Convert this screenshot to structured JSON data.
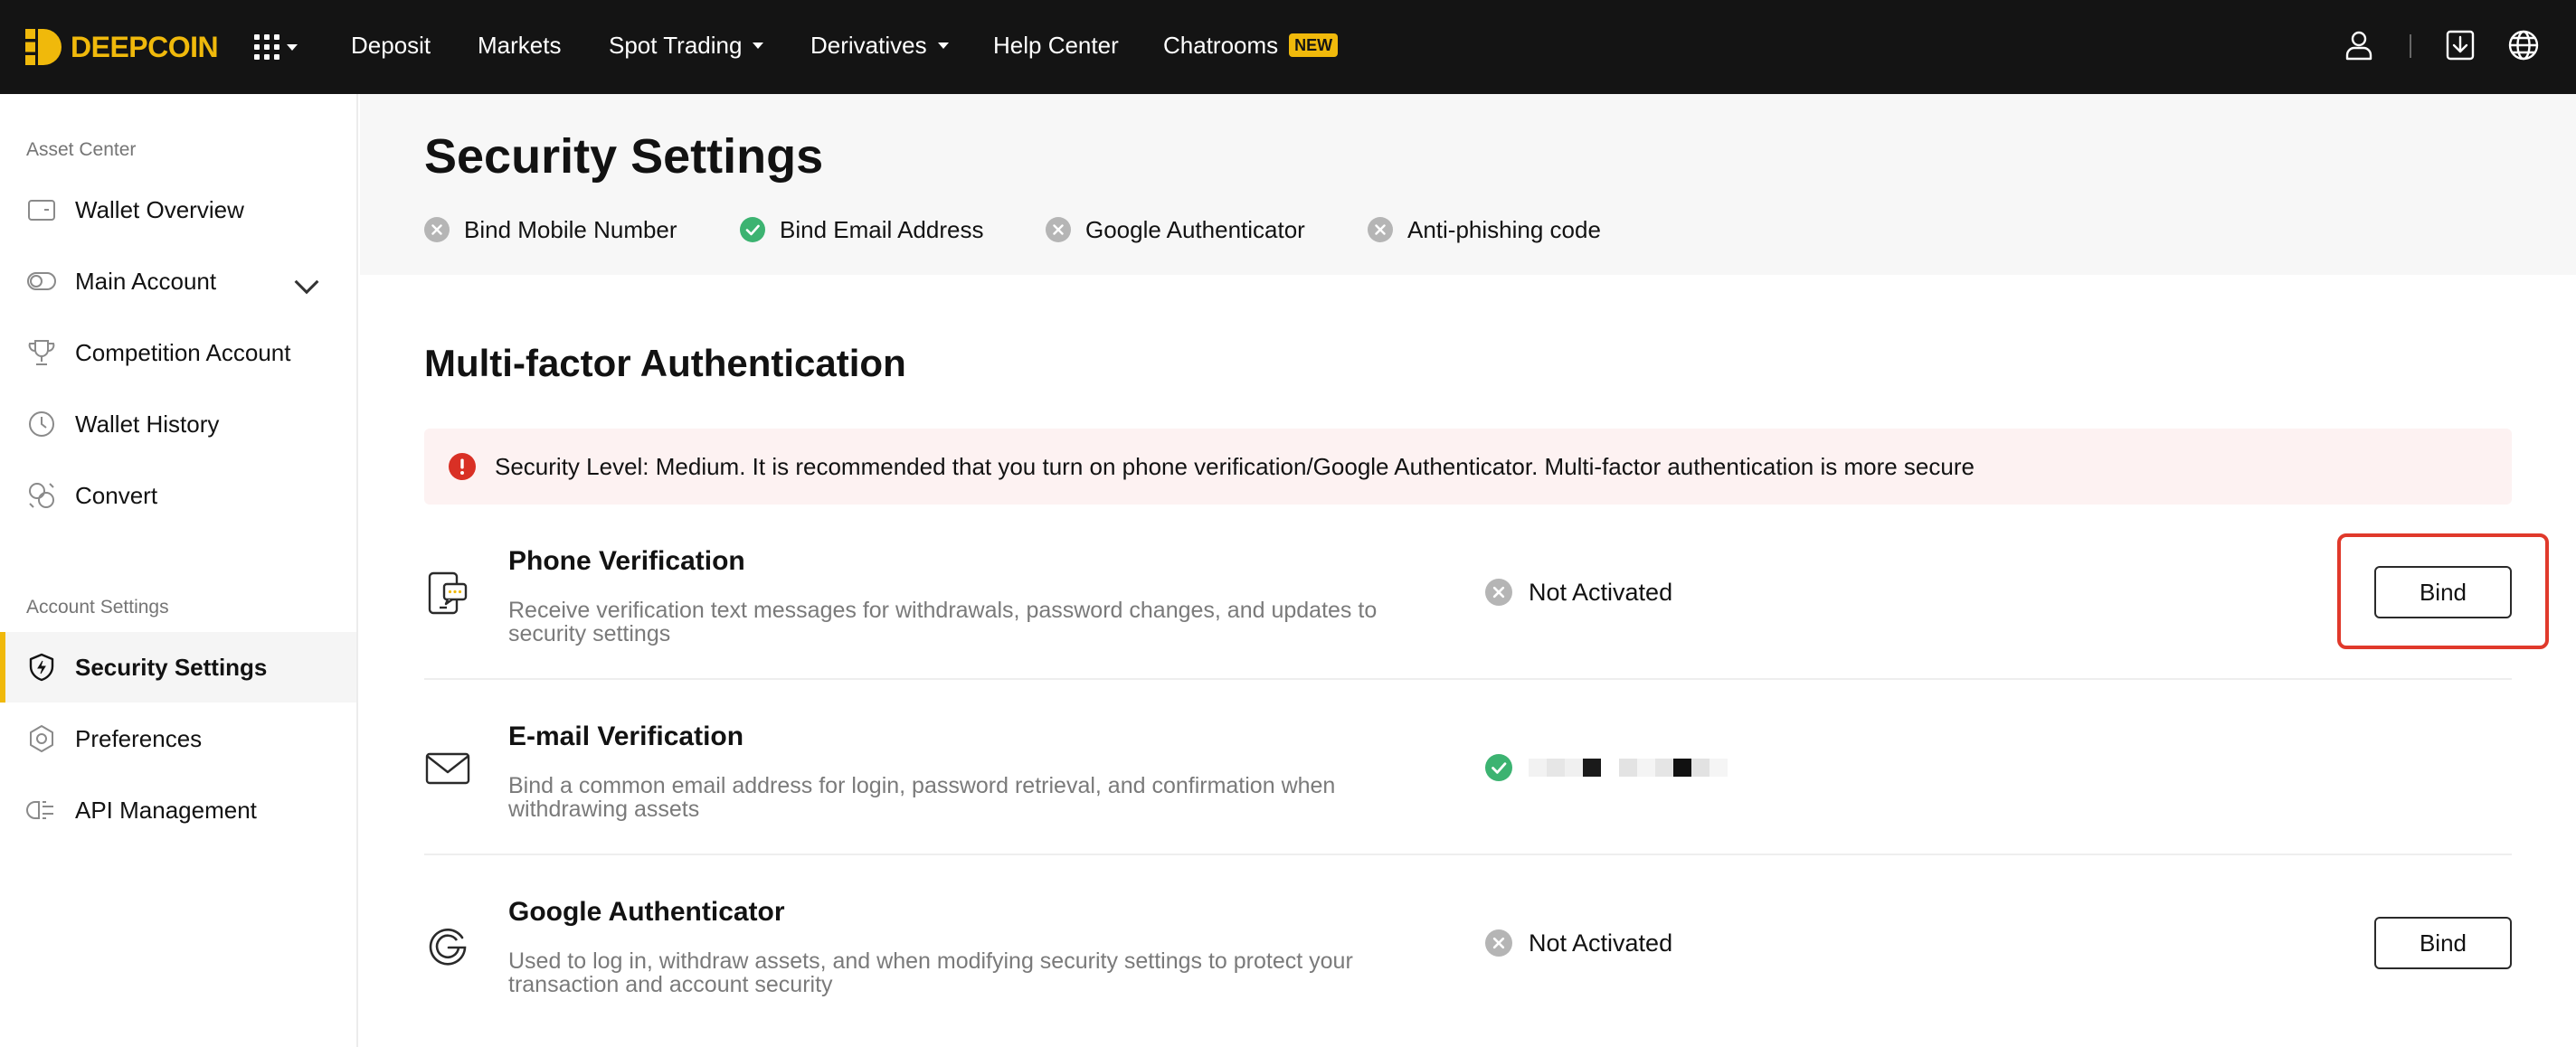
{
  "brand": {
    "name": "DEEPCOIN",
    "color": "#f0b90b"
  },
  "nav": {
    "items": [
      {
        "label": "Deposit",
        "has_caret": false
      },
      {
        "label": "Markets",
        "has_caret": false
      },
      {
        "label": "Spot Trading",
        "has_caret": true
      },
      {
        "label": "Derivatives",
        "has_caret": true
      },
      {
        "label": "Help Center",
        "has_caret": false
      },
      {
        "label": "Chatrooms",
        "has_caret": false,
        "badge": "NEW"
      }
    ],
    "right_icons": [
      "user-icon",
      "download-icon",
      "globe-icon"
    ]
  },
  "sidebar": {
    "sections": [
      {
        "title": "Asset Center",
        "items": [
          {
            "label": "Wallet Overview",
            "icon": "wallet-icon"
          },
          {
            "label": "Main Account",
            "icon": "toggle-icon",
            "expandable": true
          },
          {
            "label": "Competition Account",
            "icon": "trophy-icon"
          },
          {
            "label": "Wallet History",
            "icon": "clock-icon"
          },
          {
            "label": "Convert",
            "icon": "convert-icon"
          }
        ]
      },
      {
        "title": "Account Settings",
        "items": [
          {
            "label": "Security Settings",
            "icon": "shield-icon",
            "active": true
          },
          {
            "label": "Preferences",
            "icon": "hexagon-gear-icon"
          },
          {
            "label": "API Management",
            "icon": "api-icon"
          }
        ]
      }
    ]
  },
  "page": {
    "title": "Security Settings",
    "status": [
      {
        "label": "Bind Mobile Number",
        "state": "inactive"
      },
      {
        "label": "Bind Email Address",
        "state": "active"
      },
      {
        "label": "Google Authenticator",
        "state": "inactive"
      },
      {
        "label": "Anti-phishing code",
        "state": "inactive"
      }
    ]
  },
  "mfa": {
    "title": "Multi-factor Authentication",
    "alert": "Security Level: Medium. It is recommended that you turn on phone verification/Google Authenticator. Multi-factor authentication is more secure",
    "rows": [
      {
        "title": "Phone Verification",
        "icon": "phone-message-icon",
        "description": "Receive verification text messages for withdrawals, password changes, and updates to security settings",
        "status": "Not Activated",
        "state": "inactive",
        "button": "Bind",
        "highlighted": true
      },
      {
        "title": "E-mail Verification",
        "icon": "envelope-icon",
        "description": "Bind a common email address for login, password retrieval, and confirmation when withdrawing assets",
        "status": "",
        "state": "active",
        "masked_value": true
      },
      {
        "title": "Google Authenticator",
        "icon": "google-icon",
        "description": "Used to log in, withdraw assets, and when modifying security settings to protect your transaction and account security",
        "status": "Not Activated",
        "state": "inactive",
        "button": "Bind"
      }
    ]
  },
  "colors": {
    "success": "#3cb371",
    "inactive": "#b5b5b5",
    "danger": "#d93025",
    "highlight": "#e0392b"
  }
}
